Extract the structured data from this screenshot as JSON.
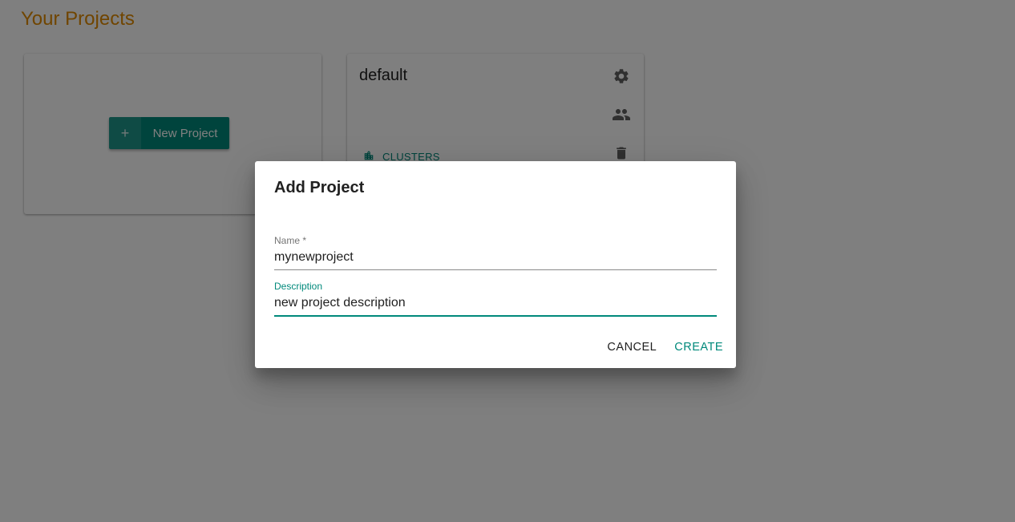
{
  "page": {
    "title": "Your Projects"
  },
  "new_project_card": {
    "button_icon": "+",
    "button_label": "New Project"
  },
  "project_cards": [
    {
      "name": "default",
      "clusters_label": "CLUSTERS"
    }
  ],
  "icons": {
    "settings": "gear-icon",
    "members": "people-icon",
    "delete": "trash-icon",
    "clusters": "cluster-icon"
  },
  "dialog": {
    "title": "Add Project",
    "name_field": {
      "label": "Name *",
      "value": "mynewproject"
    },
    "description_field": {
      "label": "Description",
      "value": "new project description"
    },
    "cancel_label": "CANCEL",
    "create_label": "CREATE"
  },
  "colors": {
    "accent": "#00897b",
    "title": "#e08a00"
  }
}
